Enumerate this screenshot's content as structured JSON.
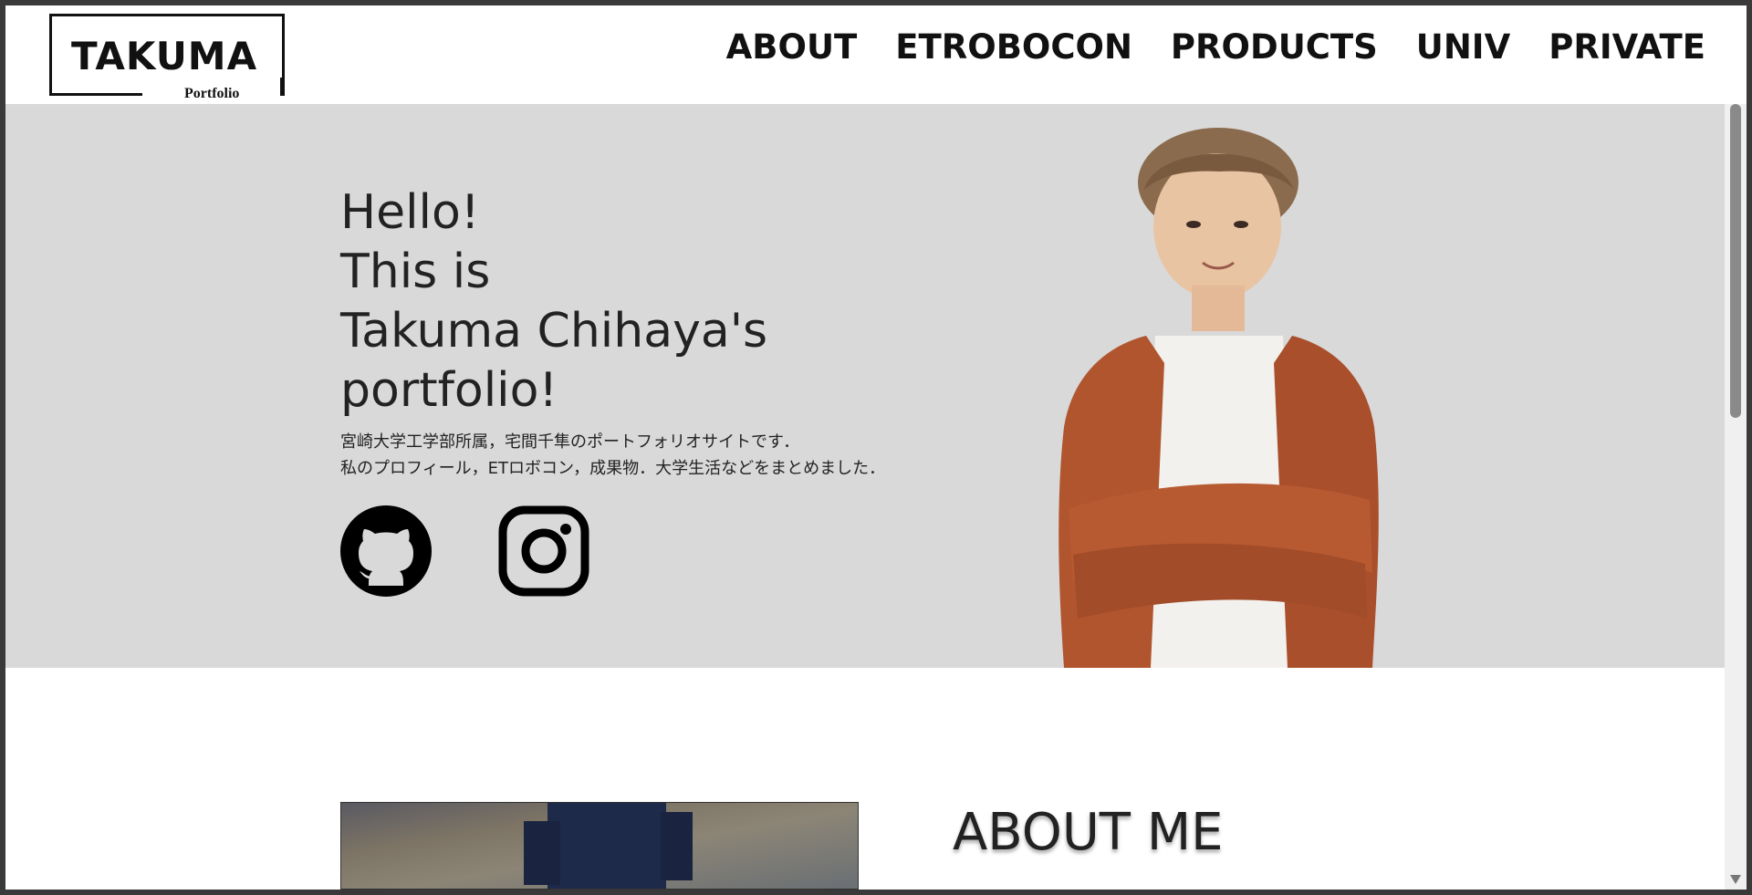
{
  "logo": {
    "title": "TAKUMA",
    "subtitle": "Portfolio"
  },
  "nav": {
    "items": [
      {
        "label": "ABOUT"
      },
      {
        "label": "ETROBOCON"
      },
      {
        "label": "PRODUCTS"
      },
      {
        "label": "UNIV"
      },
      {
        "label": "PRIVATE"
      }
    ]
  },
  "hero": {
    "title_lines": [
      "Hello!",
      "This is",
      "Takuma Chihaya's",
      "portfolio!"
    ],
    "description_lines": [
      "宮崎大学工学部所属，宅間千隼のポートフォリオサイトです．",
      "私のプロフィール，ETロボコン，成果物．大学生活などをまとめました．"
    ],
    "social": [
      {
        "icon": "github-icon"
      },
      {
        "icon": "instagram-icon"
      }
    ],
    "background_color": "#d9d9d9"
  },
  "about": {
    "title": "ABOUT ME"
  },
  "colors": {
    "text": "#222222",
    "header_bg": "#ffffff",
    "frame": "#3a3a3a"
  }
}
